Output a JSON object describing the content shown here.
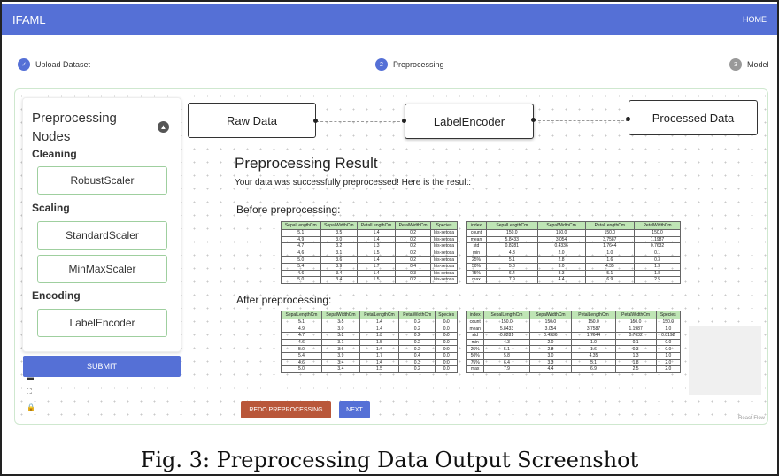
{
  "app": {
    "title": "IFAML",
    "home_label": "HOME"
  },
  "stepper": {
    "steps": [
      {
        "label": "Upload Dataset",
        "number": "✓",
        "state": "done"
      },
      {
        "label": "Preprocessing",
        "number": "2",
        "state": "active"
      },
      {
        "label": "Model",
        "number": "3",
        "state": "inactive"
      }
    ]
  },
  "sidebar": {
    "title": "Preprocessing Nodes",
    "sections": [
      {
        "label": "Cleaning",
        "nodes": [
          "RobustScaler"
        ]
      },
      {
        "label": "Scaling",
        "nodes": [
          "StandardScaler",
          "MinMaxScaler"
        ]
      },
      {
        "label": "Encoding",
        "nodes": [
          "LabelEncoder"
        ]
      }
    ],
    "submit_label": "SUBMIT"
  },
  "flow": {
    "nodes": [
      "Raw Data",
      "LabelEncoder",
      "Processed Data"
    ]
  },
  "result": {
    "title": "Preprocessing Result",
    "subtitle": "Your data was successfully preprocessed! Here is the result:",
    "before_heading": "Before preprocessing:",
    "after_heading": "After preprocessing:",
    "data_columns": [
      "SepalLengthCm",
      "SepalWidthCm",
      "PetalLengthCm",
      "PetalWidthCm",
      "Species"
    ],
    "before_rows": [
      [
        "5.1",
        "3.5",
        "1.4",
        "0.2",
        "Iris-setosa"
      ],
      [
        "4.9",
        "3.0",
        "1.4",
        "0.2",
        "Iris-setosa"
      ],
      [
        "4.7",
        "3.2",
        "1.3",
        "0.2",
        "Iris-setosa"
      ],
      [
        "4.6",
        "3.1",
        "1.5",
        "0.2",
        "Iris-setosa"
      ],
      [
        "5.0",
        "3.6",
        "1.4",
        "0.2",
        "Iris-setosa"
      ],
      [
        "5.4",
        "3.9",
        "1.7",
        "0.4",
        "Iris-setosa"
      ],
      [
        "4.6",
        "3.4",
        "1.4",
        "0.3",
        "Iris-setosa"
      ],
      [
        "5.0",
        "3.4",
        "1.5",
        "0.2",
        "Iris-setosa"
      ]
    ],
    "before_stats_columns": [
      "index",
      "SepalLengthCm",
      "SepalWidthCm",
      "PetalLengthCm",
      "PetalWidthCm"
    ],
    "before_stats_rows": [
      [
        "count",
        "150.0",
        "150.0",
        "150.0",
        "150.0"
      ],
      [
        "mean",
        "5.8433",
        "3.054",
        "3.7587",
        "1.1987"
      ],
      [
        "std",
        "0.8281",
        "0.4336",
        "1.7644",
        "0.7632"
      ],
      [
        "min",
        "4.3",
        "2.0",
        "1.0",
        "0.1"
      ],
      [
        "25%",
        "5.1",
        "2.8",
        "1.6",
        "0.3"
      ],
      [
        "50%",
        "5.8",
        "3.0",
        "4.35",
        "1.3"
      ],
      [
        "75%",
        "6.4",
        "3.3",
        "5.1",
        "1.8"
      ],
      [
        "max",
        "7.9",
        "4.4",
        "6.9",
        "2.5"
      ]
    ],
    "after_rows": [
      [
        "5.1",
        "3.5",
        "1.4",
        "0.2",
        "0.0"
      ],
      [
        "4.9",
        "3.0",
        "1.4",
        "0.2",
        "0.0"
      ],
      [
        "4.7",
        "3.2",
        "1.3",
        "0.2",
        "0.0"
      ],
      [
        "4.6",
        "3.1",
        "1.5",
        "0.2",
        "0.0"
      ],
      [
        "5.0",
        "3.6",
        "1.4",
        "0.2",
        "0.0"
      ],
      [
        "5.4",
        "3.9",
        "1.7",
        "0.4",
        "0.0"
      ],
      [
        "4.6",
        "3.4",
        "1.4",
        "0.3",
        "0.0"
      ],
      [
        "5.0",
        "3.4",
        "1.5",
        "0.2",
        "0.0"
      ]
    ],
    "after_stats_columns": [
      "index",
      "SepalLengthCm",
      "SepalWidthCm",
      "PetalLengthCm",
      "PetalWidthCm",
      "Species"
    ],
    "after_stats_rows": [
      [
        "count",
        "150.0",
        "150.0",
        "150.0",
        "150.0",
        "150.0"
      ],
      [
        "mean",
        "5.8433",
        "3.054",
        "3.7587",
        "1.1987",
        "1.0"
      ],
      [
        "std",
        "0.8281",
        "0.4336",
        "1.7644",
        "0.7632",
        "0.8192"
      ],
      [
        "min",
        "4.3",
        "2.0",
        "1.0",
        "0.1",
        "0.0"
      ],
      [
        "25%",
        "5.1",
        "2.8",
        "1.6",
        "0.3",
        "0.0"
      ],
      [
        "50%",
        "5.8",
        "3.0",
        "4.35",
        "1.3",
        "1.0"
      ],
      [
        "75%",
        "6.4",
        "3.3",
        "5.1",
        "1.8",
        "2.0"
      ],
      [
        "max",
        "7.9",
        "4.4",
        "6.9",
        "2.5",
        "2.0"
      ]
    ],
    "redo_label": "REDO PREPROCESSING",
    "next_label": "NEXT"
  },
  "attribution": "React Flow",
  "caption": "Fig. 3: Preprocessing Data Output Screenshot",
  "colors": {
    "primary": "#5570d6",
    "redo": "#b9573a",
    "table_header": "#bfe5b5",
    "node_border": "#9fcf9f"
  }
}
